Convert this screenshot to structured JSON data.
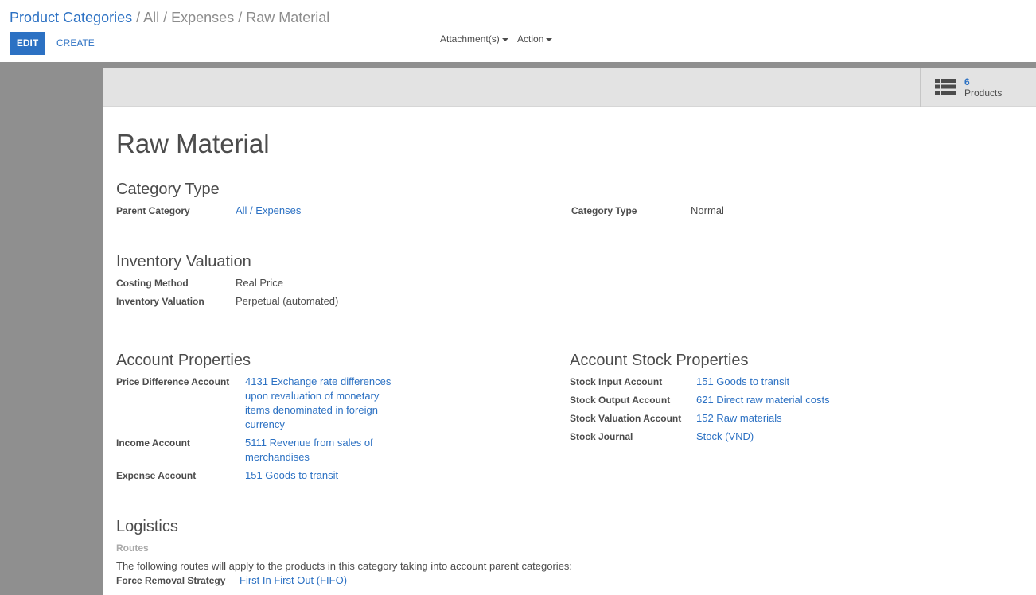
{
  "breadcrumb": {
    "parent": "Product Categories",
    "separator": "/",
    "current": "All / Expenses / Raw Material"
  },
  "toolbar": {
    "edit_label": "EDIT",
    "create_label": "CREATE",
    "attachments_label": "Attachment(s)",
    "action_label": "Action"
  },
  "stat_button": {
    "value": "6",
    "text": "Products",
    "icon": "list-icon"
  },
  "record": {
    "title": "Raw Material",
    "category_type_section": {
      "title": "Category Type",
      "parent_category_label": "Parent Category",
      "parent_category_value": "All / Expenses",
      "category_type_label": "Category Type",
      "category_type_value": "Normal"
    },
    "inventory_valuation_section": {
      "title": "Inventory Valuation",
      "costing_method_label": "Costing Method",
      "costing_method_value": "Real Price",
      "inventory_valuation_label": "Inventory Valuation",
      "inventory_valuation_value": "Perpetual (automated)"
    },
    "account_properties_section": {
      "title": "Account Properties",
      "price_difference_label": "Price Difference Account",
      "price_difference_value": "4131 Exchange rate differences upon revaluation of monetary items denominated in foreign currency",
      "income_label": "Income Account",
      "income_value": "5111 Revenue from sales of merchandises",
      "expense_label": "Expense Account",
      "expense_value": "151 Goods to transit"
    },
    "account_stock_section": {
      "title": "Account Stock Properties",
      "stock_input_label": "Stock Input Account",
      "stock_input_value": "151 Goods to transit",
      "stock_output_label": "Stock Output Account",
      "stock_output_value": "621 Direct raw material costs",
      "stock_valuation_label": "Stock Valuation Account",
      "stock_valuation_value": "152 Raw materials",
      "stock_journal_label": "Stock Journal",
      "stock_journal_value": "Stock (VND)"
    },
    "logistics_section": {
      "title": "Logistics",
      "routes_label": "Routes",
      "routes_help": "The following routes will apply to the products in this category taking into account parent categories:",
      "force_removal_label": "Force Removal Strategy",
      "force_removal_value": "First In First Out (FIFO)"
    }
  },
  "colors": {
    "accent": "#2c71c3",
    "text": "#4c4c4c",
    "background_gray": "#8f8f8f"
  }
}
